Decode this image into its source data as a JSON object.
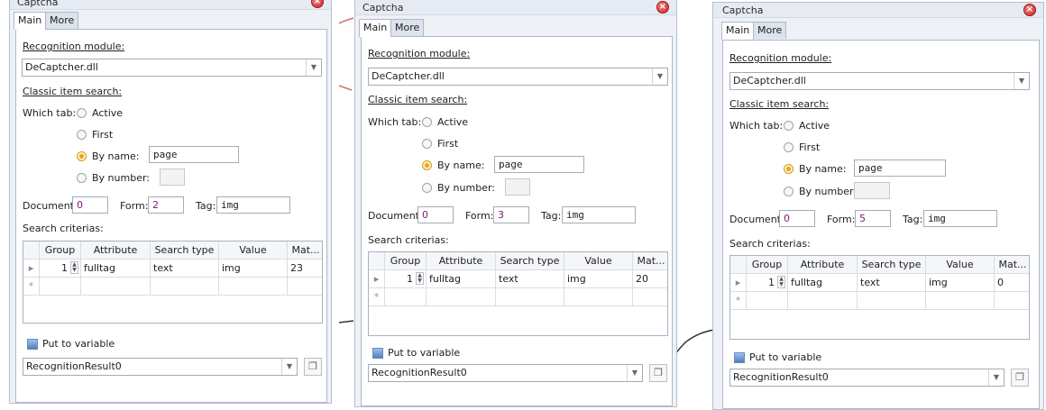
{
  "panels": [
    {
      "title": "Captcha",
      "tabs": [
        "Main",
        "More"
      ],
      "recognition_module_label": "Recognition module:",
      "recognition_module_value": "DeCaptcher.dll",
      "classic_search_label": "Classic item search:",
      "which_tab_label": "Which tab:",
      "radio_active": "Active",
      "radio_first": "First",
      "radio_by_name": "By name:",
      "radio_by_number": "By number:",
      "name_value": "page",
      "document_label": "Document:",
      "document_value": "0",
      "form_label": "Form:",
      "form_value": "2",
      "tag_label": "Tag:",
      "tag_value": "img",
      "criteria_label": "Search criterias:",
      "columns": [
        "Group",
        "Attribute",
        "Search type",
        "Value",
        "Mat..."
      ],
      "row": {
        "group": "1",
        "attribute": "fulltag",
        "search_type": "text",
        "value": "img",
        "mat": "23"
      },
      "new_row_glyph": "*",
      "row_indicator": "▸",
      "put_label": "Put to variable",
      "variable_value": "RecognitionResult0"
    },
    {
      "title": "Captcha",
      "tabs": [
        "Main",
        "More"
      ],
      "recognition_module_label": "Recognition module:",
      "recognition_module_value": "DeCaptcher.dll",
      "classic_search_label": "Classic item search:",
      "which_tab_label": "Which tab:",
      "radio_active": "Active",
      "radio_first": "First",
      "radio_by_name": "By name:",
      "radio_by_number": "By number:",
      "name_value": "page",
      "document_label": "Document:",
      "document_value": "0",
      "form_label": "Form:",
      "form_value": "3",
      "tag_label": "Tag:",
      "tag_value": "img",
      "criteria_label": "Search criterias:",
      "columns": [
        "Group",
        "Attribute",
        "Search type",
        "Value",
        "Mat..."
      ],
      "row": {
        "group": "1",
        "attribute": "fulltag",
        "search_type": "text",
        "value": "img",
        "mat": "20"
      },
      "new_row_glyph": "*",
      "row_indicator": "▸",
      "put_label": "Put to variable",
      "variable_value": "RecognitionResult0"
    },
    {
      "title": "Captcha",
      "tabs": [
        "Main",
        "More"
      ],
      "recognition_module_label": "Recognition module:",
      "recognition_module_value": "DeCaptcher.dll",
      "classic_search_label": "Classic item search:",
      "which_tab_label": "Which tab:",
      "radio_active": "Active",
      "radio_first": "First",
      "radio_by_name": "By name:",
      "radio_by_number": "By number:",
      "name_value": "page",
      "document_label": "Document:",
      "document_value": "0",
      "form_label": "Form:",
      "form_value": "5",
      "tag_label": "Tag:",
      "tag_value": "img",
      "criteria_label": "Search criterias:",
      "columns": [
        "Group",
        "Attribute",
        "Search type",
        "Value",
        "Mat..."
      ],
      "row": {
        "group": "1",
        "attribute": "fulltag",
        "search_type": "text",
        "value": "img",
        "mat": "0"
      },
      "new_row_glyph": "*",
      "row_indicator": "▸",
      "put_label": "Put to variable",
      "variable_value": "RecognitionResult0"
    }
  ],
  "colors": {
    "close_button": "#d23232",
    "selected_radio": "#e8a318",
    "purple_value": "#7a1a7a",
    "connector_line": "#333333"
  },
  "icons": {
    "close": "close-icon",
    "dropdown": "chevron-down-icon",
    "spinner": "spinner-icon",
    "variable": "variable-icon",
    "copy": "copy-icon"
  }
}
